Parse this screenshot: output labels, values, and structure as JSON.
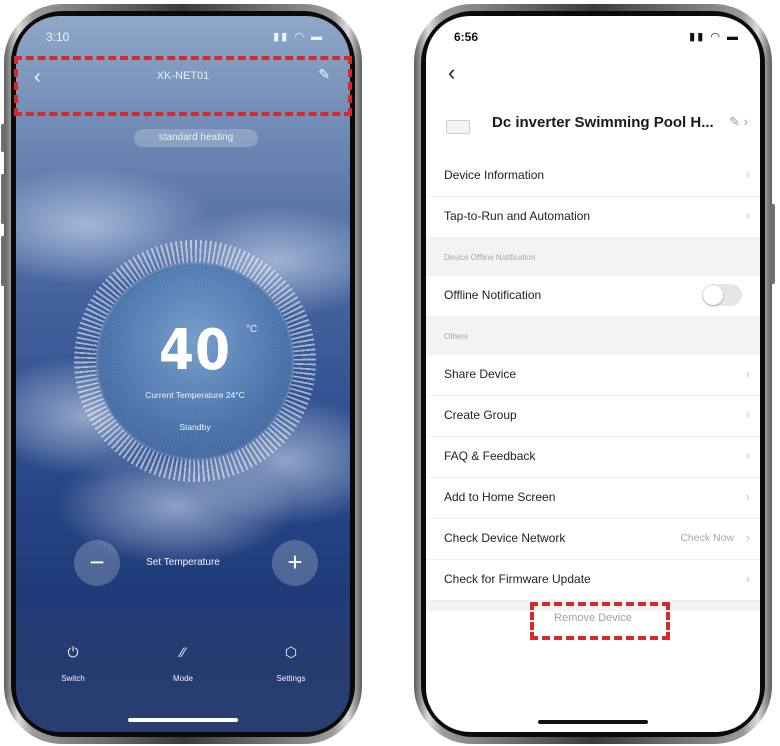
{
  "left_screen": {
    "status_time": "3:10",
    "device_title": "XK-NET01",
    "mode": "standard heating",
    "set_temperature_value": "40",
    "unit": "°C",
    "current_temperature": "Current Temperature 24°C",
    "state": "Standby",
    "minus_label": "−",
    "plus_label": "+",
    "set_temperature_label": "Set Temperature",
    "tabs": [
      {
        "label": "Switch",
        "icon": "power-icon"
      },
      {
        "label": "Mode",
        "icon": "mode-icon"
      },
      {
        "label": "Settings",
        "icon": "settings-icon"
      }
    ]
  },
  "right_screen": {
    "status_time": "6:56",
    "device_name": "Dc inverter Swimming Pool H...",
    "rows_top": [
      {
        "label": "Device Information"
      },
      {
        "label": "Tap-to-Run and Automation"
      }
    ],
    "section_offline": "Device Offline Notification",
    "offline_notification": {
      "label": "Offline Notification",
      "enabled": false
    },
    "section_others": "Others",
    "rows_others": [
      {
        "label": "Share Device",
        "value": ""
      },
      {
        "label": "Create Group",
        "value": ""
      },
      {
        "label": "FAQ & Feedback",
        "value": ""
      },
      {
        "label": "Add to Home Screen",
        "value": ""
      },
      {
        "label": "Check Device Network",
        "value": "Check Now"
      },
      {
        "label": "Check for Firmware Update",
        "value": ""
      }
    ],
    "remove_device": "Remove Device"
  },
  "highlight_color": "#d62a2a"
}
